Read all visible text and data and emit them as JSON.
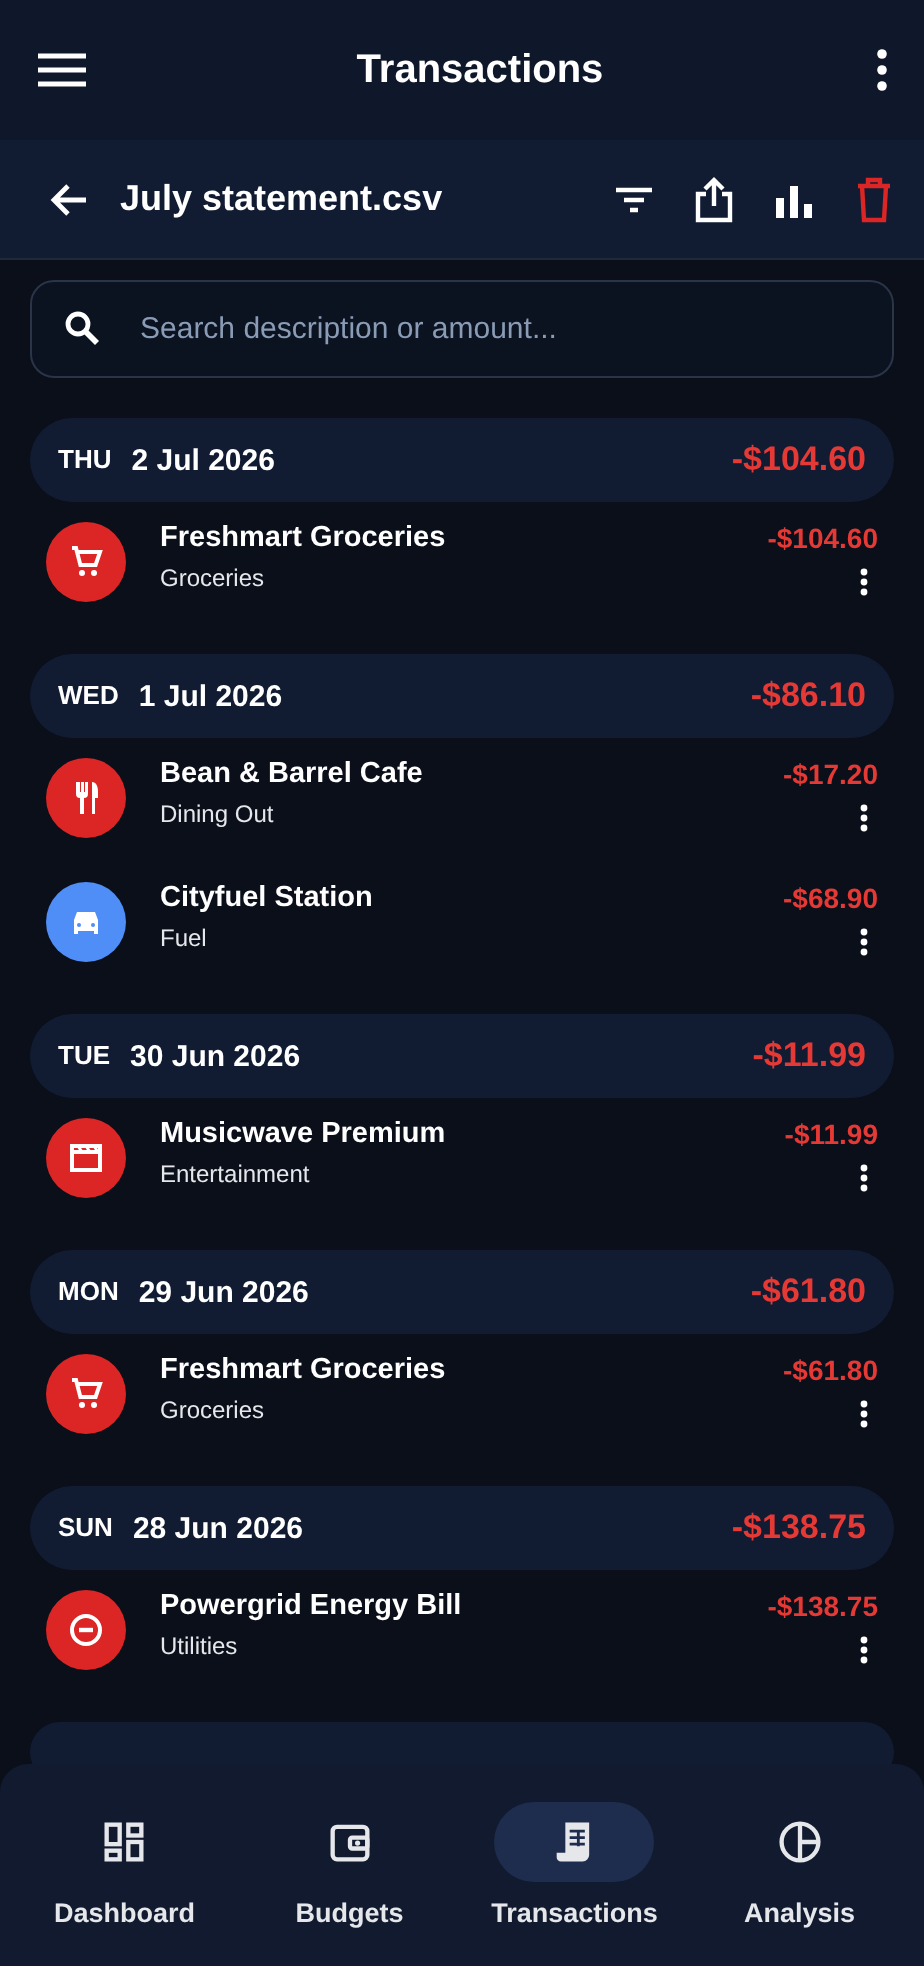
{
  "app_bar": {
    "title": "Transactions"
  },
  "file_bar": {
    "title": "July statement.csv"
  },
  "search": {
    "placeholder": "Search description or amount..."
  },
  "days": [
    {
      "weekday": "THU",
      "date": "2 Jul 2026",
      "total": "-$104.60",
      "transactions": [
        {
          "kind": "cart",
          "color": "#dc2626",
          "name": "Freshmart Groceries",
          "category": "Groceries",
          "amount": "-$104.60"
        }
      ]
    },
    {
      "weekday": "WED",
      "date": "1 Jul 2026",
      "total": "-$86.10",
      "transactions": [
        {
          "kind": "dining",
          "color": "#dc2626",
          "name": "Bean & Barrel Cafe",
          "category": "Dining Out",
          "amount": "-$17.20"
        },
        {
          "kind": "car",
          "color": "#4f8ef7",
          "name": "Cityfuel Station",
          "category": "Fuel",
          "amount": "-$68.90"
        }
      ]
    },
    {
      "weekday": "TUE",
      "date": "30 Jun 2026",
      "total": "-$11.99",
      "transactions": [
        {
          "kind": "film",
          "color": "#dc2626",
          "name": "Musicwave Premium",
          "category": "Entertainment",
          "amount": "-$11.99"
        }
      ]
    },
    {
      "weekday": "MON",
      "date": "29 Jun 2026",
      "total": "-$61.80",
      "transactions": [
        {
          "kind": "cart",
          "color": "#dc2626",
          "name": "Freshmart Groceries",
          "category": "Groceries",
          "amount": "-$61.80"
        }
      ]
    },
    {
      "weekday": "SUN",
      "date": "28 Jun 2026",
      "total": "-$138.75",
      "transactions": [
        {
          "kind": "block",
          "color": "#dc2626",
          "name": "Powergrid Energy Bill",
          "category": "Utilities",
          "amount": "-$138.75"
        }
      ]
    }
  ],
  "nav": [
    {
      "kind": "dashboard",
      "label": "Dashboard",
      "selected": false
    },
    {
      "kind": "wallet",
      "label": "Budgets",
      "selected": false
    },
    {
      "kind": "receipt",
      "label": "Transactions",
      "selected": true
    },
    {
      "kind": "pie",
      "label": "Analysis",
      "selected": false
    }
  ]
}
